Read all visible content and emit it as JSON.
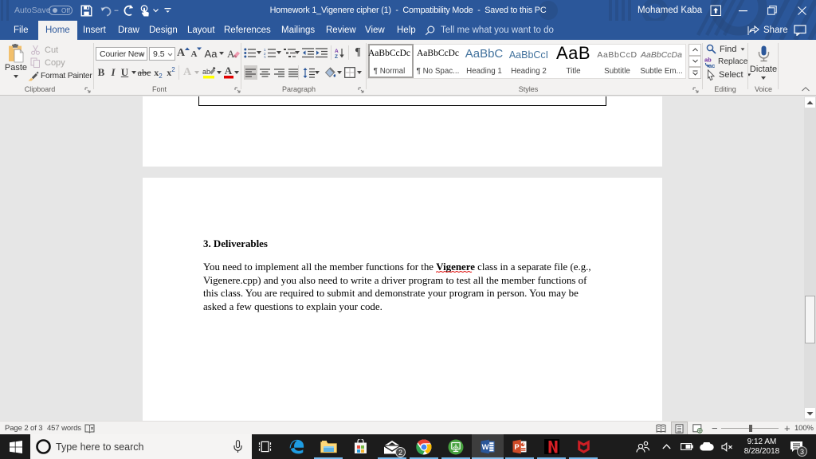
{
  "titlebar": {
    "autosave_label": "AutoSave",
    "autosave_state": "Off",
    "title": "Homework 1_Vigenere cipher (1)  -  Compatibility Mode  -  Saved to this PC",
    "user": "Mohamed Kaba"
  },
  "tabs": [
    {
      "label": "File"
    },
    {
      "label": "Home"
    },
    {
      "label": "Insert"
    },
    {
      "label": "Draw"
    },
    {
      "label": "Design"
    },
    {
      "label": "Layout"
    },
    {
      "label": "References"
    },
    {
      "label": "Mailings"
    },
    {
      "label": "Review"
    },
    {
      "label": "View"
    },
    {
      "label": "Help"
    }
  ],
  "tellme": {
    "placeholder": "Tell me what you want to do"
  },
  "share_label": "Share",
  "ribbon": {
    "clipboard": {
      "label": "Clipboard",
      "paste": "Paste",
      "cut": "Cut",
      "copy": "Copy",
      "format_painter": "Format Painter"
    },
    "font": {
      "label": "Font",
      "font_name": "Courier New",
      "font_size": "9.5",
      "bold": "B",
      "italic": "I",
      "underline": "U",
      "strike": "abc",
      "subscript": "x",
      "superscript": "x",
      "case": "Aa",
      "grow": "A",
      "shrink": "A",
      "effects": "A",
      "highlight": "ab",
      "color": "A"
    },
    "paragraph": {
      "label": "Paragraph"
    },
    "styles": {
      "label": "Styles",
      "items": [
        {
          "sample": "AaBbCcDc",
          "name": "¶ Normal"
        },
        {
          "sample": "AaBbCcDc",
          "name": "¶ No Spac..."
        },
        {
          "sample": "AaBbC",
          "name": "Heading 1"
        },
        {
          "sample": "AaBbCcI",
          "name": "Heading 2"
        },
        {
          "sample": "AaB",
          "name": "Title"
        },
        {
          "sample": "AaBbCcD",
          "name": "Subtitle"
        },
        {
          "sample": "AaBbCcDa",
          "name": "Subtle Em..."
        }
      ]
    },
    "editing": {
      "label": "Editing",
      "find": "Find",
      "replace": "Replace",
      "select": "Select"
    },
    "voice": {
      "label": "Voice",
      "dictate": "Dictate"
    }
  },
  "document": {
    "heading": "3. Deliverables",
    "line1_pre": "You need to implement all the member functions for the ",
    "line1_bold": "Vigenere",
    "line1_post": " class in a separate file (e.g.,",
    "line2": "Vigenere.cpp) and you also need to write a driver program to test all the member functions of",
    "line3": "this class. You are required to submit and demonstrate your program in person. You may be",
    "line4": "asked a few questions to explain your code."
  },
  "statusbar": {
    "page": "Page 2 of 3",
    "words": "457 words",
    "zoom": "100%",
    "zoom_minus": "−",
    "zoom_plus": "+"
  },
  "taskbar": {
    "search_placeholder": "Type here to search",
    "time": "9:12 AM",
    "date": "8/28/2018",
    "mail_badge": "2",
    "notif_badge": "3"
  }
}
